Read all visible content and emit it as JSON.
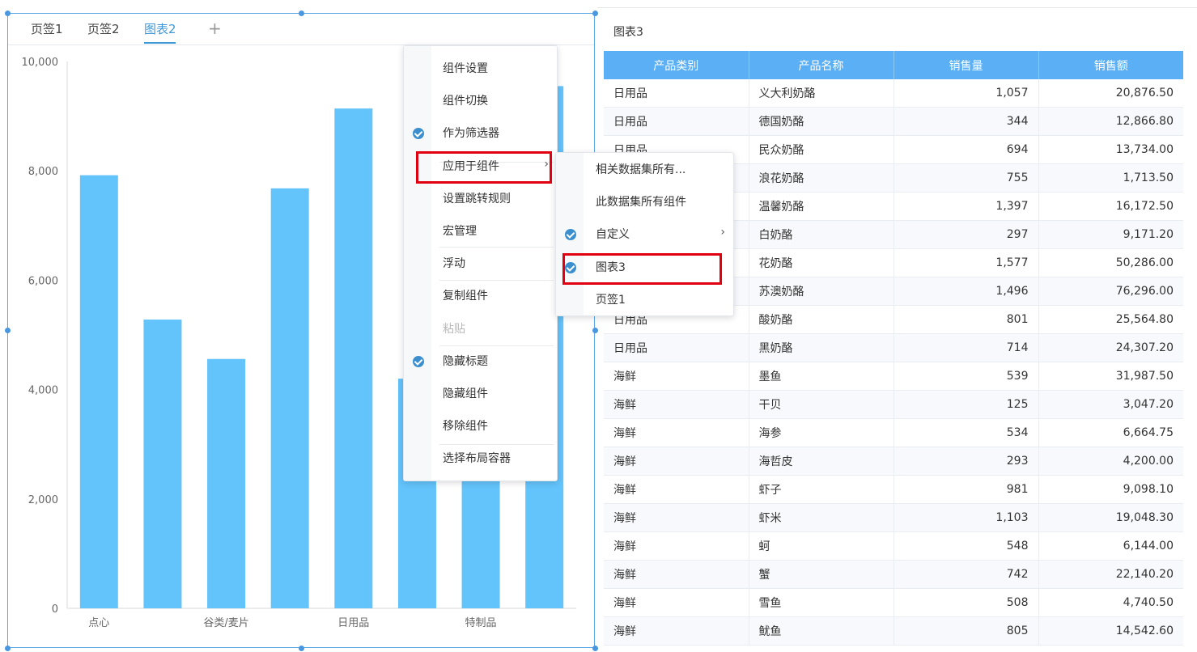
{
  "tabs": [
    {
      "label": "页签1",
      "active": false
    },
    {
      "label": "页签2",
      "active": false
    },
    {
      "label": "图表2",
      "active": true
    }
  ],
  "add_tab_label": "+",
  "chart_data": {
    "type": "bar",
    "categories": [
      "点心",
      "",
      "谷类/麦片",
      "",
      "日用品",
      "",
      "特制品",
      ""
    ],
    "values": [
      7920,
      5280,
      4560,
      7680,
      9140,
      4200,
      7600,
      9550
    ],
    "ylim": [
      0,
      10000
    ],
    "yticks": [
      "0",
      "2,000",
      "4,000",
      "6,000",
      "8,000",
      "10,000"
    ],
    "bar_color": "#63c3fb",
    "grid": false
  },
  "table": {
    "title": "图表3",
    "header_color": "#5bb0f5",
    "columns": [
      "产品类别",
      "产品名称",
      "销售量",
      "销售额"
    ],
    "rows": [
      [
        "日用品",
        "义大利奶酪",
        "1,057",
        "20,876.50"
      ],
      [
        "日用品",
        "德国奶酪",
        "344",
        "12,866.80"
      ],
      [
        "日用品",
        "民众奶酪",
        "694",
        "13,734.00"
      ],
      [
        "日用品",
        "浪花奶酪",
        "755",
        "1,713.50"
      ],
      [
        "日用品",
        "温馨奶酪",
        "1,397",
        "16,172.50"
      ],
      [
        "日用品",
        "白奶酪",
        "297",
        "9,171.20"
      ],
      [
        "日用品",
        "花奶酪",
        "1,577",
        "50,286.00"
      ],
      [
        "日用品",
        "苏澳奶酪",
        "1,496",
        "76,296.00"
      ],
      [
        "日用品",
        "酸奶酪",
        "801",
        "25,564.80"
      ],
      [
        "日用品",
        "黑奶酪",
        "714",
        "24,307.20"
      ],
      [
        "海鲜",
        "墨鱼",
        "539",
        "31,987.50"
      ],
      [
        "海鲜",
        "干贝",
        "125",
        "3,047.20"
      ],
      [
        "海鲜",
        "海参",
        "534",
        "6,664.75"
      ],
      [
        "海鲜",
        "海哲皮",
        "293",
        "4,200.00"
      ],
      [
        "海鲜",
        "虾子",
        "981",
        "9,098.10"
      ],
      [
        "海鲜",
        "虾米",
        "1,103",
        "19,048.30"
      ],
      [
        "海鲜",
        "蚵",
        "548",
        "6,144.00"
      ],
      [
        "海鲜",
        "蟹",
        "742",
        "22,140.20"
      ],
      [
        "海鲜",
        "雪鱼",
        "508",
        "4,740.50"
      ],
      [
        "海鲜",
        "鱿鱼",
        "805",
        "14,542.60"
      ]
    ]
  },
  "context_menu": {
    "items": [
      {
        "label": "组件设置",
        "checked": false,
        "submenu": false,
        "disabled": false
      },
      {
        "label": "组件切换",
        "checked": false,
        "submenu": false,
        "disabled": false
      },
      {
        "label": "作为筛选器",
        "checked": true,
        "submenu": false,
        "disabled": false
      },
      {
        "label": "应用于组件",
        "checked": false,
        "submenu": true,
        "disabled": false
      },
      {
        "label": "设置跳转规则",
        "checked": false,
        "submenu": false,
        "disabled": false
      },
      {
        "label": "宏管理",
        "checked": false,
        "submenu": false,
        "disabled": false
      },
      {
        "label": "浮动",
        "checked": false,
        "submenu": false,
        "disabled": false
      },
      {
        "label": "复制组件",
        "checked": false,
        "submenu": false,
        "disabled": false
      },
      {
        "label": "粘贴",
        "checked": false,
        "submenu": false,
        "disabled": true
      },
      {
        "label": "隐藏标题",
        "checked": true,
        "submenu": false,
        "disabled": false
      },
      {
        "label": "隐藏组件",
        "checked": false,
        "submenu": false,
        "disabled": false
      },
      {
        "label": "移除组件",
        "checked": false,
        "submenu": false,
        "disabled": false
      },
      {
        "label": "选择布局容器",
        "checked": false,
        "submenu": false,
        "disabled": false
      }
    ]
  },
  "submenu": {
    "items": [
      {
        "label": "相关数据集所有...",
        "checked": false,
        "submenu": false
      },
      {
        "label": "此数据集所有组件",
        "checked": false,
        "submenu": false
      },
      {
        "label": "自定义",
        "checked": true,
        "submenu": true
      },
      {
        "label": "图表3",
        "checked": true,
        "submenu": false
      },
      {
        "label": "页签1",
        "checked": false,
        "submenu": false
      }
    ]
  },
  "highlight_color": "#e0000f",
  "accent_color": "#3f98d8",
  "icons": {
    "check": "check-circle-icon",
    "submenu_arrow": "chevron-right-icon"
  }
}
